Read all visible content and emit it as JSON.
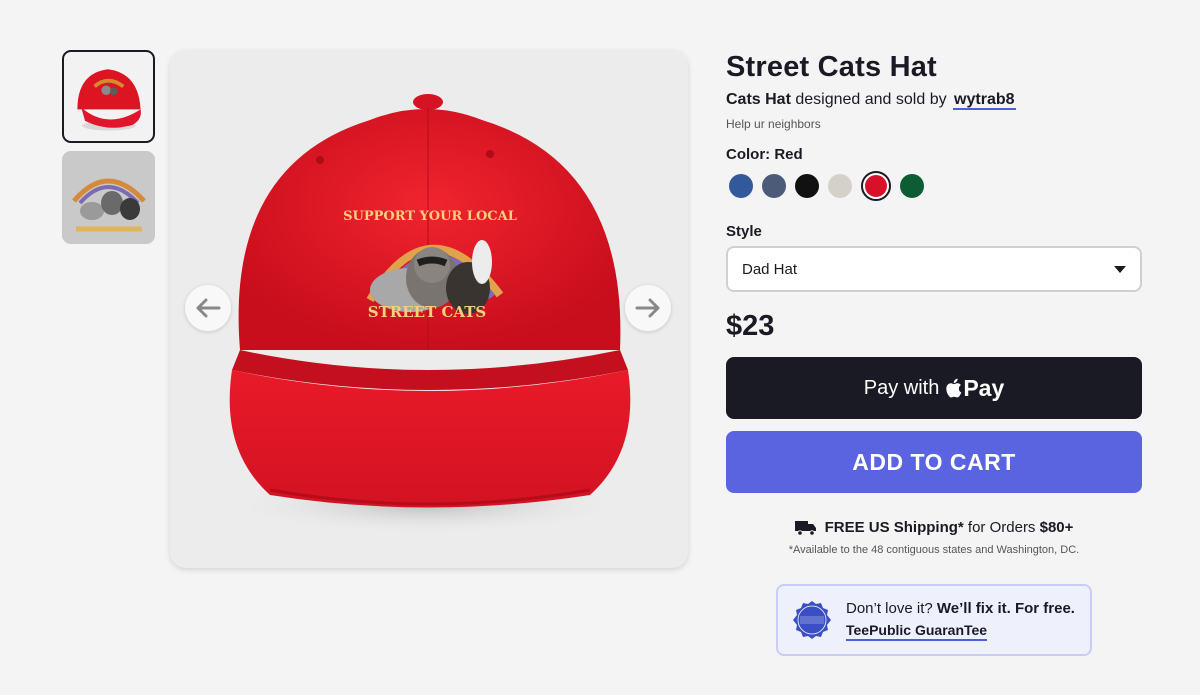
{
  "product": {
    "title": "Street Cats Hat",
    "design_name": "Cats Hat",
    "byline_middle": "designed and sold by",
    "artist": "wytrab8",
    "tagline": "Help ur neighbors",
    "color_label": "Color: Red",
    "colors": [
      {
        "name": "royal-blue",
        "hex": "#34589c"
      },
      {
        "name": "slate",
        "hex": "#4c5b78"
      },
      {
        "name": "black",
        "hex": "#111111"
      },
      {
        "name": "stone",
        "hex": "#d4d2c8"
      },
      {
        "name": "red",
        "hex": "#d8102a",
        "selected": true
      },
      {
        "name": "forest-green",
        "hex": "#0c5d34"
      }
    ],
    "style_label": "Style",
    "style_value": "Dad Hat",
    "price": "$23"
  },
  "artwork": {
    "top_text": "SUPPORT YOUR LOCAL",
    "bottom_text": "STREET CATS"
  },
  "buttons": {
    "apple_pay_prefix": "Pay with",
    "apple_pay_word": "Pay",
    "add_to_cart": "ADD TO CART"
  },
  "shipping": {
    "bold1": "FREE US Shipping*",
    "middle": "for Orders",
    "bold2": "$80+",
    "note": "*Available to the 48 contiguous states and Washington, DC."
  },
  "guarantee": {
    "text": "Don’t love it?",
    "bold": "We’ll fix it. For free.",
    "link": "TeePublic GuaranTee"
  },
  "icons": {
    "left_arrow": "arrow-left-icon",
    "right_arrow": "arrow-right-icon",
    "truck": "truck-icon",
    "apple": "apple-logo-icon",
    "badge": "guarantee-badge-icon"
  }
}
